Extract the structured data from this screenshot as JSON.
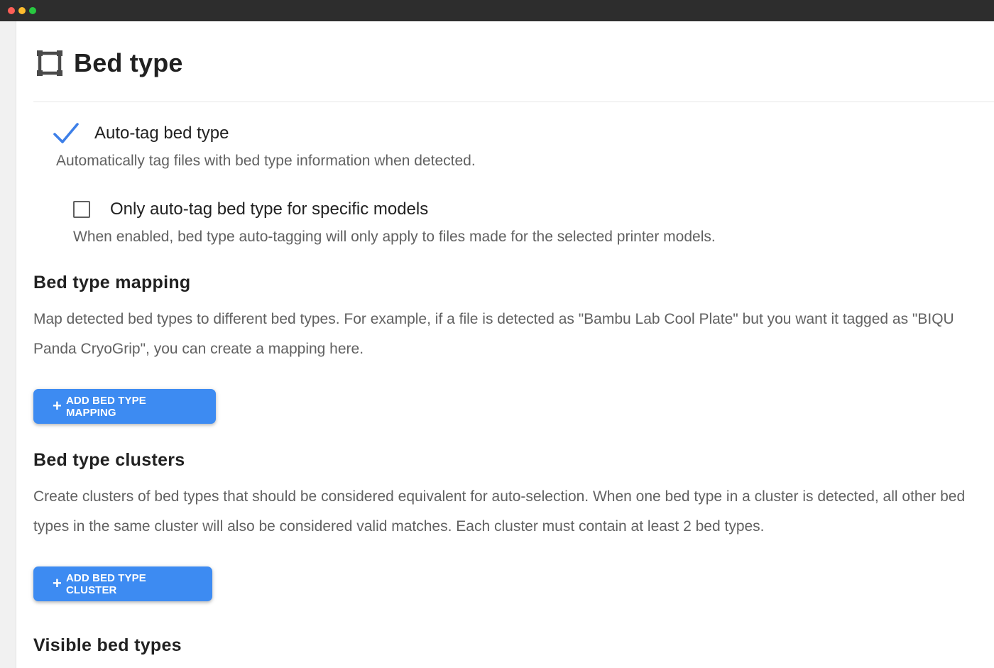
{
  "window": {
    "controls": [
      "close",
      "minimize",
      "maximize"
    ]
  },
  "header": {
    "icon": "bed-frame-icon",
    "title": "Bed type"
  },
  "auto_tag": {
    "label": "Auto-tag bed type",
    "checked": true,
    "description": "Automatically tag files with bed type information when detected."
  },
  "specific_models": {
    "label": "Only auto-tag bed type for specific models",
    "checked": false,
    "description": "When enabled, bed type auto-tagging will only apply to files made for the selected printer models."
  },
  "mapping": {
    "title": "Bed type mapping",
    "description_line1": "Map detected bed types to different bed types. For example, if a file is detected as \"Bambu Lab Cool Plate\" but you want it tagged as \"BIQU",
    "description_line2": "Panda CryoGrip\", you can create a mapping here.",
    "button_icon": "+",
    "button_label": "ADD BED TYPE MAPPING"
  },
  "clusters": {
    "title": "Bed type clusters",
    "description_line1": "Create clusters of bed types that should be considered equivalent for auto-selection. When one bed type in a cluster is detected, all other bed",
    "description_line2": "types in the same cluster will also be considered valid matches. Each cluster must contain at least 2 bed types.",
    "button_icon": "+",
    "button_label": "ADD BED TYPE CLUSTER"
  },
  "visible": {
    "title": "Visible bed types"
  },
  "colors": {
    "accent": "#3d8bf2",
    "checkmark": "#3d7fe8",
    "titlebar": "#2d2d2d",
    "text_primary": "#212121",
    "text_secondary": "#616161"
  }
}
